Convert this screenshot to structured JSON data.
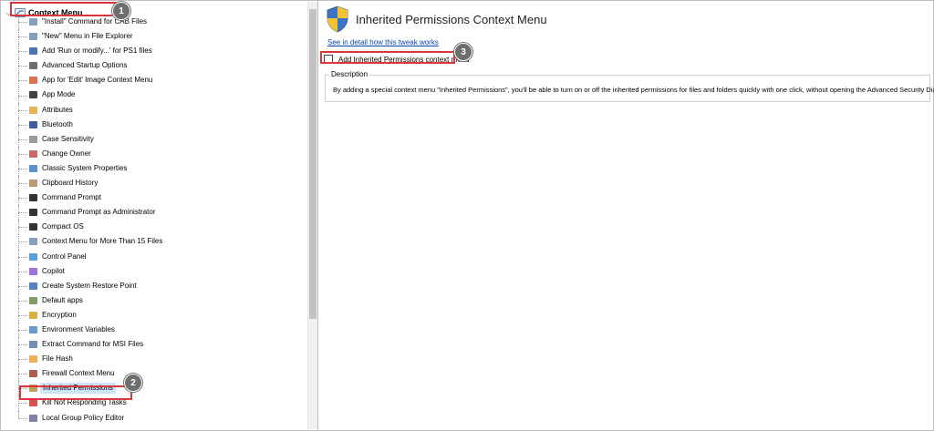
{
  "tree": {
    "root_label": "Context Menu",
    "items": [
      {
        "label": "\"Install\" Command for CAB Files",
        "icon": "context-menu-icon",
        "color": "#6f8fb3"
      },
      {
        "label": "\"New\" Menu in File Explorer",
        "icon": "context-menu-icon",
        "color": "#6f8fb3"
      },
      {
        "label": "Add 'Run or modify...' for PS1 files",
        "icon": "powershell-icon",
        "color": "#2a5aa8"
      },
      {
        "label": "Advanced Startup Options",
        "icon": "spinner-icon",
        "color": "#555555"
      },
      {
        "label": "App for 'Edit' Image Context Menu",
        "icon": "paint-icon",
        "color": "#d45a2a"
      },
      {
        "label": "App Mode",
        "icon": "app-mode-icon",
        "color": "#222222"
      },
      {
        "label": "Attributes",
        "icon": "document-icon",
        "color": "#e8a23a"
      },
      {
        "label": "Bluetooth",
        "icon": "bluetooth-icon",
        "color": "#1f3f8f"
      },
      {
        "label": "Case Sensitivity",
        "icon": "drive-icon",
        "color": "#8a8a8a"
      },
      {
        "label": "Change Owner",
        "icon": "user-icon",
        "color": "#c0504d"
      },
      {
        "label": "Classic System Properties",
        "icon": "monitor-icon",
        "color": "#3c7fc4"
      },
      {
        "label": "Clipboard History",
        "icon": "clipboard-icon",
        "color": "#b08a5a"
      },
      {
        "label": "Command Prompt",
        "icon": "console-icon",
        "color": "#111111"
      },
      {
        "label": "Command Prompt as Administrator",
        "icon": "console-icon",
        "color": "#111111"
      },
      {
        "label": "Compact OS",
        "icon": "console-icon",
        "color": "#111111"
      },
      {
        "label": "Context Menu for More Than 15 Files",
        "icon": "context-menu-icon",
        "color": "#6f8fb3"
      },
      {
        "label": "Control Panel",
        "icon": "control-panel-icon",
        "color": "#3c8fd4"
      },
      {
        "label": "Copilot",
        "icon": "copilot-icon",
        "color": "#8a5ad4"
      },
      {
        "label": "Create System Restore Point",
        "icon": "restore-icon",
        "color": "#3a6ab4"
      },
      {
        "label": "Default apps",
        "icon": "default-apps-icon",
        "color": "#6a8a4a"
      },
      {
        "label": "Encryption",
        "icon": "lock-icon",
        "color": "#d4a020"
      },
      {
        "label": "Environment Variables",
        "icon": "environment-icon",
        "color": "#4a8ac4"
      },
      {
        "label": "Extract Command for MSI Files",
        "icon": "msi-icon",
        "color": "#5a7aa4"
      },
      {
        "label": "File Hash",
        "icon": "document-icon",
        "color": "#e8a23a"
      },
      {
        "label": "Firewall Context Menu",
        "icon": "firewall-icon",
        "color": "#a04030"
      },
      {
        "label": "Inherited Permissions",
        "icon": "permissions-icon",
        "color": "#b09040",
        "selected": true
      },
      {
        "label": "Kill Not Responding Tasks",
        "icon": "error-icon",
        "color": "#d03030"
      },
      {
        "label": "Local Group Policy Editor",
        "icon": "policy-icon",
        "color": "#6a6a9a"
      }
    ]
  },
  "annotations": {
    "one": "1",
    "two": "2",
    "three": "3",
    "box_color": "#d9363e"
  },
  "panel": {
    "title": "Inherited Permissions Context Menu",
    "link": "See in detail how this tweak works",
    "checkbox_label": "Add Inherited Permissions context menu",
    "checkbox_checked": false,
    "description_label": "Description",
    "description": "By adding a special context menu \"Inherited Permissions\", you'll be able to turn on or off the inherited permissions for files and folders quickly with one click, without opening the Advanced Security Dialog."
  }
}
